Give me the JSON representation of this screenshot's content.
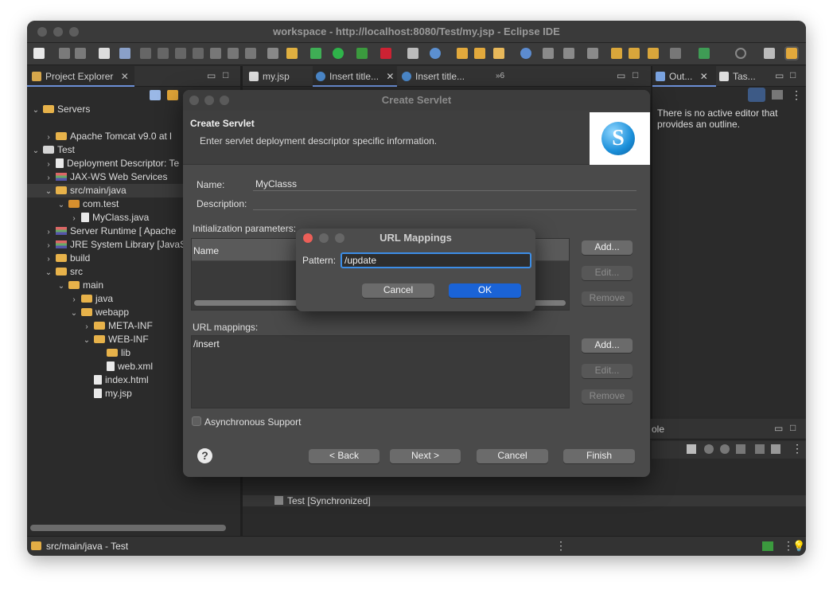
{
  "window": {
    "title": "workspace - http://localhost:8080/Test/my.jsp - Eclipse IDE"
  },
  "project_explorer": {
    "tab_label": "Project Explorer",
    "tree": [
      {
        "label": "Servers",
        "indent": 0,
        "chev": "v",
        "icon": "folder"
      },
      {
        "label": "Apache Tomcat v9.0 at l",
        "indent": 1,
        "chev": ">",
        "icon": "folder"
      },
      {
        "label": "Test",
        "indent": 0,
        "chev": "v",
        "icon": "project"
      },
      {
        "label": "Deployment Descriptor: Te",
        "indent": 1,
        "chev": ">",
        "icon": "dd"
      },
      {
        "label": "JAX-WS Web Services",
        "indent": 1,
        "chev": ">",
        "icon": "ws"
      },
      {
        "label": "src/main/java",
        "indent": 1,
        "chev": "v",
        "icon": "folder"
      },
      {
        "label": "com.test",
        "indent": 2,
        "chev": "v",
        "icon": "pkg"
      },
      {
        "label": "MyClass.java",
        "indent": 3,
        "chev": ">",
        "icon": "java"
      },
      {
        "label": "Server Runtime [   Apache",
        "indent": 1,
        "chev": ">",
        "icon": "lib"
      },
      {
        "label": "JRE System Library [JavaS",
        "indent": 1,
        "chev": ">",
        "icon": "lib"
      },
      {
        "label": "build",
        "indent": 1,
        "chev": ">",
        "icon": "folder"
      },
      {
        "label": "src",
        "indent": 1,
        "chev": "v",
        "icon": "folder"
      },
      {
        "label": "main",
        "indent": 2,
        "chev": "v",
        "icon": "folder"
      },
      {
        "label": "java",
        "indent": 3,
        "chev": ">",
        "icon": "folder"
      },
      {
        "label": "webapp",
        "indent": 3,
        "chev": "v",
        "icon": "folder"
      },
      {
        "label": "META-INF",
        "indent": 4,
        "chev": ">",
        "icon": "folder"
      },
      {
        "label": "WEB-INF",
        "indent": 4,
        "chev": "v",
        "icon": "folder"
      },
      {
        "label": "lib",
        "indent": 5,
        "chev": "",
        "icon": "folder"
      },
      {
        "label": "web.xml",
        "indent": 5,
        "chev": "",
        "icon": "xml"
      },
      {
        "label": "index.html",
        "indent": 4,
        "chev": "",
        "icon": "file"
      },
      {
        "label": "my.jsp",
        "indent": 4,
        "chev": "",
        "icon": "file"
      }
    ]
  },
  "editor_tabs": [
    {
      "label": "my.jsp"
    },
    {
      "label": "Insert title..."
    },
    {
      "label": "Insert title..."
    },
    {
      "label": "»6"
    }
  ],
  "outline": {
    "tab_label": "Out...",
    "tasks_label": "Tas...",
    "message": "There is no active editor that provides an outline."
  },
  "console": {
    "tab_partial": "ole",
    "server_row": "Test  [Synchronized]"
  },
  "status_bar": {
    "text": "src/main/java - Test"
  },
  "create_servlet": {
    "title": "Create Servlet",
    "heading": "Create Servlet",
    "subtitle": "Enter servlet deployment descriptor specific information.",
    "name_label": "Name:",
    "name_value": "MyClasss",
    "description_label": "Description:",
    "description_value": "",
    "init_params_label": "Initialization parameters:",
    "init_table_header": "Name",
    "url_mappings_label": "URL mappings:",
    "url_mappings": [
      "/insert"
    ],
    "buttons": {
      "add": "Add...",
      "edit": "Edit...",
      "remove": "Remove"
    },
    "async_label": "Asynchronous Support",
    "async_checked": false,
    "footer": {
      "back": "< Back",
      "next": "Next >",
      "cancel": "Cancel",
      "finish": "Finish"
    }
  },
  "url_mappings_dialog": {
    "title": "URL Mappings",
    "pattern_label": "Pattern:",
    "pattern_value": "/update",
    "cancel": "Cancel",
    "ok": "OK"
  }
}
